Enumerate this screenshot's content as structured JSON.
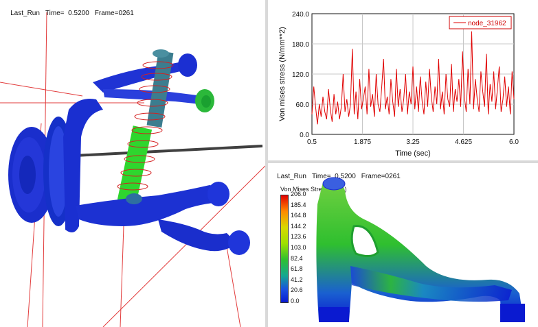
{
  "viewport_3d": {
    "run_label": "Last_Run",
    "time_label": "Time=  0.5200",
    "frame_label": "Frame=0261"
  },
  "stress_plot": {
    "legend": "node_31962",
    "xlabel": "Time (sec)",
    "ylabel": "Von mises stress (N/mm**2)",
    "xticks": [
      "0.5",
      "1.875",
      "3.25",
      "4.625",
      "6.0"
    ],
    "yticks": [
      "0.0",
      "60.0",
      "120.0",
      "180.0",
      "240.0"
    ],
    "colors": {
      "line": "#e00000",
      "grid": "#c8c8c8"
    }
  },
  "contour_view": {
    "run_label": "Last_Run",
    "time_label": "Time=  0.5200",
    "frame_label": "Frame=0261",
    "colorbar_title": "Von Mises Stress (MPa)",
    "colorbar_labels": [
      "206.0",
      "185.4",
      "164.8",
      "144.2",
      "123.6",
      "103.0",
      "82.4",
      "61.8",
      "41.2",
      "20.6",
      "0.0"
    ],
    "colors": {
      "max": "#e00000",
      "mid": "#2fbf2f",
      "min": "#0a1ad0"
    }
  },
  "chart_data": {
    "type": "line",
    "title": "",
    "xlabel": "Time (sec)",
    "ylabel": "Von mises stress (N/mm**2)",
    "xlim": [
      0.5,
      6.0
    ],
    "ylim": [
      0.0,
      240.0
    ],
    "grid": true,
    "legend_position": "top-right",
    "series": [
      {
        "name": "node_31962",
        "x": [
          0.5,
          0.55,
          0.6,
          0.65,
          0.7,
          0.75,
          0.8,
          0.85,
          0.9,
          0.95,
          1.0,
          1.05,
          1.1,
          1.15,
          1.2,
          1.25,
          1.3,
          1.35,
          1.4,
          1.45,
          1.5,
          1.55,
          1.6,
          1.65,
          1.7,
          1.75,
          1.8,
          1.85,
          1.9,
          1.95,
          2.0,
          2.05,
          2.1,
          2.15,
          2.2,
          2.25,
          2.3,
          2.35,
          2.4,
          2.45,
          2.5,
          2.55,
          2.6,
          2.65,
          2.7,
          2.75,
          2.8,
          2.85,
          2.9,
          2.95,
          3.0,
          3.05,
          3.1,
          3.15,
          3.2,
          3.25,
          3.3,
          3.35,
          3.4,
          3.45,
          3.5,
          3.55,
          3.6,
          3.65,
          3.7,
          3.75,
          3.8,
          3.85,
          3.9,
          3.95,
          4.0,
          4.05,
          4.1,
          4.15,
          4.2,
          4.25,
          4.3,
          4.35,
          4.4,
          4.45,
          4.5,
          4.55,
          4.6,
          4.65,
          4.7,
          4.75,
          4.8,
          4.85,
          4.9,
          4.95,
          5.0,
          5.05,
          5.1,
          5.15,
          5.2,
          5.25,
          5.3,
          5.35,
          5.4,
          5.45,
          5.5,
          5.55,
          5.6,
          5.65,
          5.7,
          5.75,
          5.8,
          5.85,
          5.9,
          5.95,
          6.0
        ],
        "values": [
          40,
          95,
          55,
          20,
          60,
          35,
          75,
          45,
          30,
          90,
          50,
          25,
          80,
          40,
          65,
          30,
          55,
          120,
          45,
          70,
          35,
          60,
          170,
          40,
          85,
          30,
          110,
          50,
          70,
          95,
          40,
          130,
          55,
          80,
          35,
          120,
          60,
          45,
          95,
          150,
          50,
          75,
          40,
          110,
          65,
          35,
          130,
          55,
          90,
          45,
          70,
          120,
          40,
          85,
          60,
          135,
          50,
          95,
          45,
          115,
          65,
          40,
          105,
          55,
          130,
          75,
          45,
          95,
          60,
          150,
          50,
          85,
          40,
          120,
          70,
          55,
          140,
          45,
          90,
          65,
          110,
          55,
          165,
          75,
          45,
          130,
          60,
          205,
          50,
          110,
          70,
          45,
          125,
          85,
          55,
          160,
          40,
          100,
          65,
          125,
          50,
          90,
          135,
          45,
          70,
          115,
          55,
          95,
          40,
          125,
          70
        ]
      }
    ]
  }
}
